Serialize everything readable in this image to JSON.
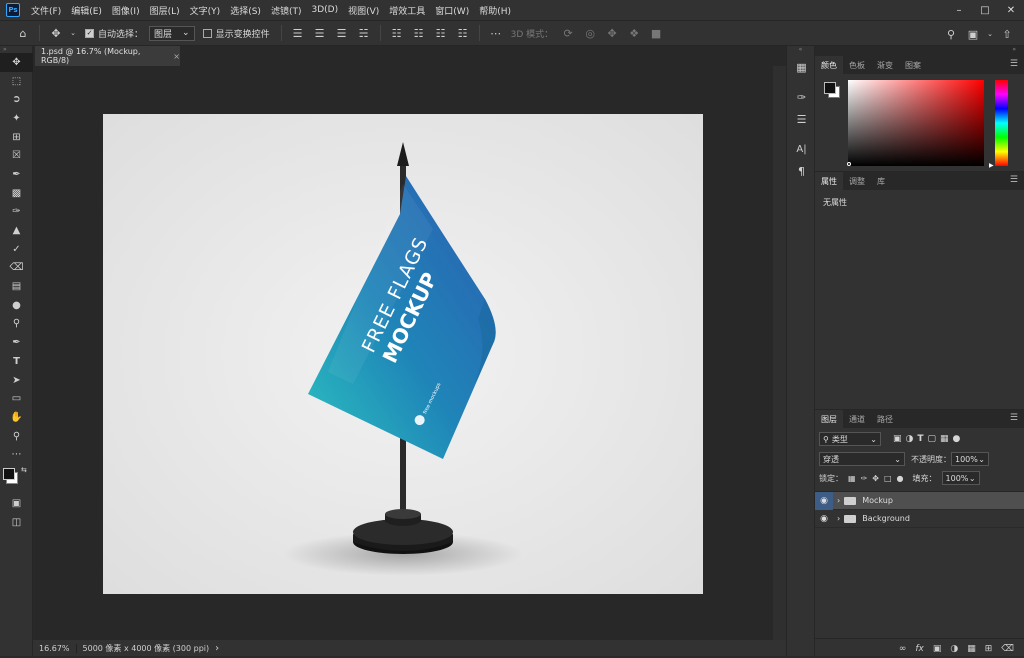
{
  "app": {
    "logo": "Ps"
  },
  "menu": [
    "文件(F)",
    "编辑(E)",
    "图像(I)",
    "图层(L)",
    "文字(Y)",
    "选择(S)",
    "滤镜(T)",
    "3D(D)",
    "视图(V)",
    "增效工具",
    "窗口(W)",
    "帮助(H)"
  ],
  "window_controls": [
    "minimize-icon",
    "restore-icon",
    "close-icon"
  ],
  "options": {
    "auto_select_label": "自动选择：",
    "auto_select_value": "图层",
    "show_transform_label": "显示变换控件",
    "mode_3d_label": "3D 模式："
  },
  "document_tab": {
    "title": "1.psd @ 16.7% (Mockup, RGB/8)",
    "close": "×"
  },
  "status": {
    "zoom": "16.67%",
    "info": "5000 像素 x 4000 像素 (300 ppi)",
    "arrow": "›"
  },
  "artwork": {
    "line1": "FREE FLAGS",
    "line2": "MOCKUP",
    "badge": "free mockups"
  },
  "color_panel": {
    "tabs": [
      "颜色",
      "色板",
      "渐变",
      "图案"
    ],
    "fg": "#111111",
    "bg": "#ffffff",
    "hue": "#ff0000"
  },
  "properties_panel": {
    "tabs": [
      "属性",
      "调整",
      "库"
    ],
    "empty": "无属性"
  },
  "layers_panel": {
    "tabs": [
      "图层",
      "通道",
      "路径"
    ],
    "filter_label": "类型",
    "blend_mode": "穿透",
    "opacity_label": "不透明度：",
    "opacity_value": "100%",
    "lock_label": "锁定：",
    "fill_label": "填充：",
    "fill_value": "100%",
    "layers": [
      {
        "name": "Mockup",
        "selected": true
      },
      {
        "name": "Background",
        "selected": false
      }
    ]
  },
  "colors": {
    "accent": "#31a8ff",
    "selected_layer": "#4f4f4f"
  }
}
